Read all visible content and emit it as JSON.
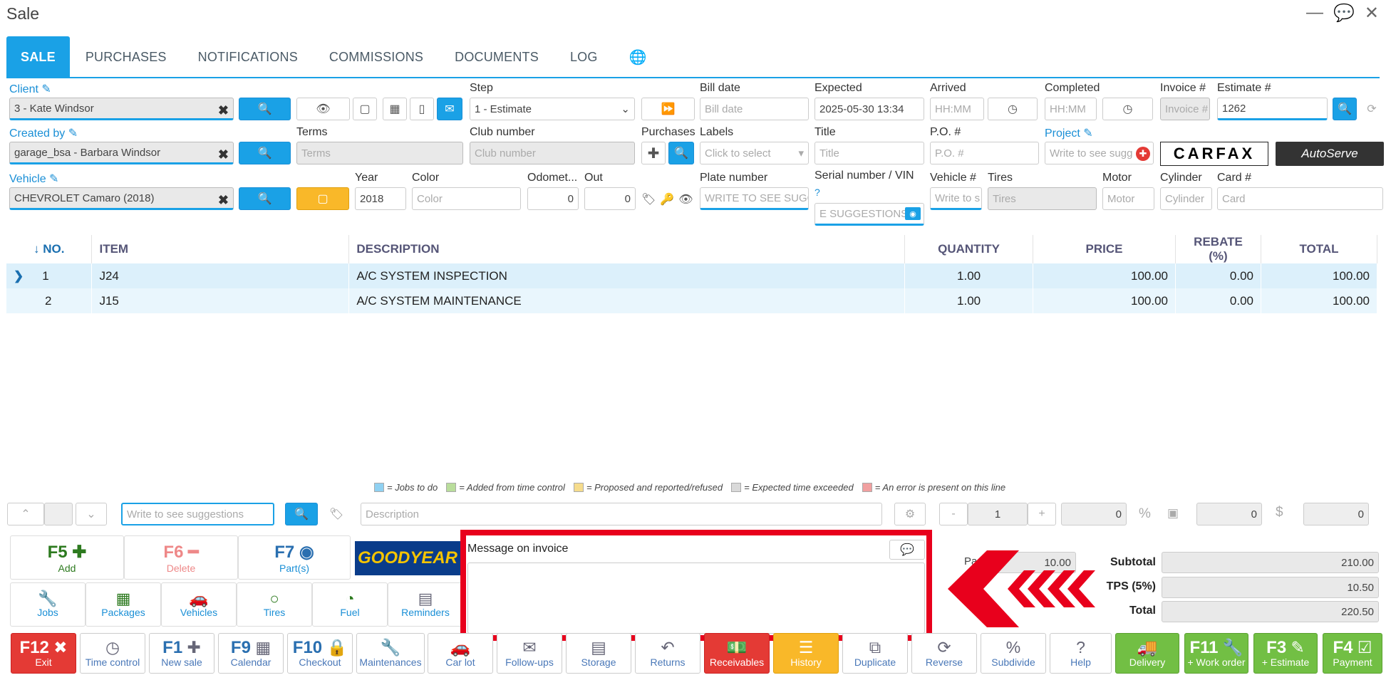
{
  "window": {
    "title": "Sale",
    "minimize": "—",
    "chat": "💬",
    "close": "✕"
  },
  "tabs": [
    "SALE",
    "PURCHASES",
    "NOTIFICATIONS",
    "COMMISSIONS",
    "DOCUMENTS",
    "LOG"
  ],
  "form": {
    "client_label": "Client",
    "client_value": "3 - Kate Windsor",
    "created_by_label": "Created by",
    "created_by_value": "garage_bsa - Barbara Windsor",
    "vehicle_label": "Vehicle",
    "vehicle_value": "CHEVROLET Camaro (2018)",
    "step_label": "Step",
    "step_value": "1 - Estimate",
    "terms_label": "Terms",
    "terms_ph": "Terms",
    "club_label": "Club number",
    "club_ph": "Club number",
    "purchases_label": "Purchases",
    "labels_label": "Labels",
    "labels_ph": "Click to select",
    "year_label": "Year",
    "year_value": "2018",
    "color_label": "Color",
    "color_ph": "Color",
    "odometer_label": "Odomet...",
    "odometer_value": "0",
    "out_label": "Out",
    "out_value": "0",
    "bill_date_label": "Bill date",
    "bill_date_ph": "Bill date",
    "expected_label": "Expected",
    "expected_value": "2025-05-30 13:34",
    "arrived_label": "Arrived",
    "arrived_ph": "HH:MM",
    "completed_label": "Completed",
    "completed_ph": "HH:MM",
    "invoice_label": "Invoice #",
    "invoice_ph": "Invoice #",
    "estimate_label": "Estimate #",
    "estimate_value": "1262",
    "title_label": "Title",
    "title_ph": "Title",
    "po_label": "P.O. #",
    "po_ph": "P.O. #",
    "project_label": "Project",
    "project_ph": "Write to see sugg",
    "plate_label": "Plate number",
    "plate_ph": "WRITE TO SEE SUGG",
    "serial_label": "Serial number / VIN",
    "serial_ph": "E SUGGESTIONS",
    "vehicle_no_label": "Vehicle #",
    "vehicle_no_ph": "Write to s",
    "tires_label": "Tires",
    "tires_ph": "Tires",
    "motor_label": "Motor",
    "motor_ph": "Motor",
    "cylinder_label": "Cylinder",
    "cylinder_ph": "Cylinder",
    "card_label": "Card #",
    "card_ph": "Card",
    "carfax": "CARFAX",
    "autoserve": "AutoServe"
  },
  "grid": {
    "headers": [
      "↓ NO.",
      "ITEM",
      "DESCRIPTION",
      "QUANTITY",
      "PRICE",
      "REBATE (%)",
      "TOTAL"
    ],
    "rows": [
      {
        "no": "1",
        "item": "J24",
        "desc": "A/C SYSTEM INSPECTION",
        "qty": "1.00",
        "price": "100.00",
        "rebate": "0.00",
        "total": "100.00"
      },
      {
        "no": "2",
        "item": "J15",
        "desc": "A/C SYSTEM MAINTENANCE",
        "qty": "1.00",
        "price": "100.00",
        "rebate": "0.00",
        "total": "100.00"
      }
    ]
  },
  "legend": [
    {
      "color": "#8fd1f2",
      "text": "= Jobs to do"
    },
    {
      "color": "#b9dd9b",
      "text": "= Added from time control"
    },
    {
      "color": "#f6dc8c",
      "text": "= Proposed and reported/refused"
    },
    {
      "color": "#d9d9d9",
      "text": "= Expected time exceeded"
    },
    {
      "color": "#f1a0a0",
      "text": "= An error is present on this line"
    }
  ],
  "edit_row": {
    "search_ph": "Write to see suggestions",
    "desc_ph": "Description",
    "qty": "1",
    "v1": "0",
    "v2": "0",
    "v3": "0"
  },
  "func": {
    "f5": "F5",
    "add": "Add",
    "f6": "F6",
    "delete": "Delete",
    "f7": "F7",
    "parts": "Part(s)",
    "goodyear": "GOODYEAR",
    "jobs": "Jobs",
    "packages": "Packages",
    "vehicles": "Vehicles",
    "tires": "Tires",
    "fuel": "Fuel",
    "reminders": "Reminders"
  },
  "message": {
    "label": "Message on invoice",
    "value": ""
  },
  "totals": {
    "pa_label": "Pa",
    "pa_value": "10.00",
    "subtotal_label": "Subtotal",
    "subtotal": "210.00",
    "tps_label": "TPS (5%)",
    "tps": "10.50",
    "total_label": "Total",
    "total": "220.50"
  },
  "bottom": [
    {
      "k": "F12",
      "t": "Exit",
      "style": "red",
      "ic": "✖"
    },
    {
      "k": "",
      "t": "Time control",
      "ic": "◷"
    },
    {
      "k": "F1",
      "t": "New sale",
      "ic": "✚"
    },
    {
      "k": "F9",
      "t": "Calendar",
      "ic": "▦"
    },
    {
      "k": "F10",
      "t": "Checkout",
      "ic": "🔒"
    },
    {
      "k": "",
      "t": "Maintenances",
      "ic": "🔧"
    },
    {
      "k": "",
      "t": "Car lot",
      "ic": "🚗"
    },
    {
      "k": "",
      "t": "Follow-ups",
      "ic": "✉"
    },
    {
      "k": "",
      "t": "Storage",
      "ic": "▤"
    },
    {
      "k": "",
      "t": "Returns",
      "ic": "↶"
    },
    {
      "k": "",
      "t": "Receivables",
      "style": "red",
      "ic": "💵"
    },
    {
      "k": "",
      "t": "History",
      "style": "orange",
      "ic": "☰"
    },
    {
      "k": "",
      "t": "Duplicate",
      "ic": "⧉"
    },
    {
      "k": "",
      "t": "Reverse",
      "ic": "⟳"
    },
    {
      "k": "",
      "t": "Subdivide",
      "ic": "%"
    },
    {
      "k": "",
      "t": "Help",
      "ic": "?"
    },
    {
      "k": "",
      "t": "Delivery",
      "style": "green",
      "ic": "🚚"
    },
    {
      "k": "F11",
      "t": "+ Work order",
      "style": "green",
      "ic": "🔧"
    },
    {
      "k": "F3",
      "t": "+ Estimate",
      "style": "green",
      "ic": "✎"
    },
    {
      "k": "F4",
      "t": "Payment",
      "style": "green",
      "ic": "☑"
    }
  ]
}
